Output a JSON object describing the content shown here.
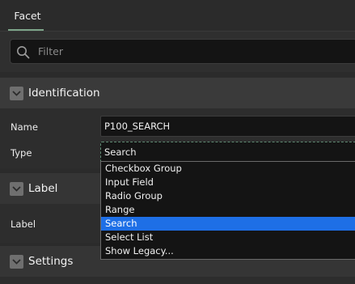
{
  "tabs": [
    {
      "label": "Facet"
    }
  ],
  "filter": {
    "placeholder": "Filter",
    "value": ""
  },
  "sections": {
    "identification": {
      "title": "Identification"
    },
    "label": {
      "title": "Label"
    },
    "settings": {
      "title": "Settings"
    }
  },
  "fields": {
    "name": {
      "label": "Name",
      "value": "P100_SEARCH"
    },
    "type": {
      "label": "Type",
      "value": "Search"
    },
    "label": {
      "label": "Label",
      "value": ""
    }
  },
  "type_options": [
    "Checkbox Group",
    "Input Field",
    "Radio Group",
    "Range",
    "Search",
    "Select List",
    "Show Legacy..."
  ],
  "selected_option": "Search",
  "icons": {
    "filter": "search-icon",
    "collapse": "chevron-down-icon"
  },
  "colors": {
    "accent": "#7da58a",
    "selection": "#1e6fe6"
  }
}
